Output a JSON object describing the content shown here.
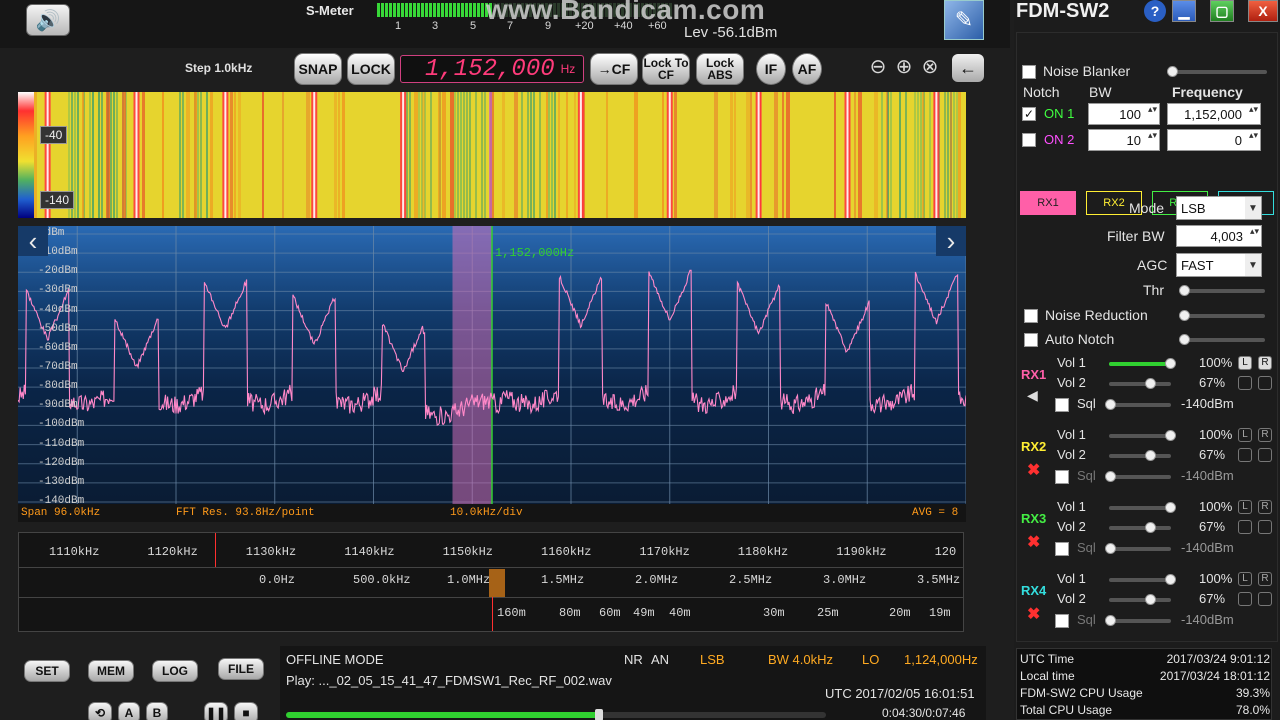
{
  "watermark": "www.Bandicam.com",
  "smeter": {
    "label": "S-Meter",
    "scale": [
      "1",
      "3",
      "5",
      "7",
      "9",
      "+20",
      "+40",
      "+60"
    ],
    "level_text": "Lev -56.1dBm"
  },
  "toolbar": {
    "step": "Step 1.0kHz",
    "snap": "SNAP",
    "lock": "LOCK",
    "frequency": "1,152,000",
    "freq_unit": "Hz",
    "to_cf": "→CF",
    "lock_to_cf": "Lock To CF",
    "lock_abs": "Lock ABS",
    "if": "IF",
    "af": "AF"
  },
  "waterfall": {
    "scale_labels": [
      "-40",
      "-140"
    ]
  },
  "spectrum": {
    "db_labels": [
      "0dBm",
      "-10dBm",
      "-20dBm",
      "-30dBm",
      "-40dBm",
      "-50dBm",
      "-60dBm",
      "-70dBm",
      "-80dBm",
      "-90dBm",
      "-100dBm",
      "-110dBm",
      "-120dBm",
      "-130dBm",
      "-140dBm"
    ],
    "marker_label": "1,152,000Hz",
    "footer": {
      "span": "Span 96.0kHz",
      "fft": "FFT Res. 93.8Hz/point",
      "div": "10.0kHz/div",
      "avg": "AVG = 8"
    }
  },
  "chart_data": {
    "type": "line",
    "x_unit": "kHz",
    "y_unit": "dBm",
    "xlim": [
      1104,
      1200
    ],
    "ylim": [
      -140,
      0
    ],
    "grid": true,
    "peaks_khz": [
      1107,
      1116,
      1125,
      1134,
      1143,
      1161,
      1170,
      1179,
      1188,
      1197
    ],
    "noise_floor_dbm": -85
  },
  "ruler": {
    "khz_ticks": [
      "1110kHz",
      "1120kHz",
      "1130kHz",
      "1140kHz",
      "1150kHz",
      "1160kHz",
      "1170kHz",
      "1180kHz",
      "1190kHz",
      "120"
    ],
    "mhz_ticks": [
      "0.0Hz",
      "500.0kHz",
      "1.0MHz",
      "1.5MHz",
      "2.0MHz",
      "2.5MHz",
      "3.0MHz",
      "3.5MHz"
    ],
    "bands": [
      "160m",
      "80m",
      "60m",
      "49m",
      "40m",
      "30m",
      "25m",
      "20m",
      "19m"
    ]
  },
  "bottom": {
    "buttons": [
      "SET",
      "MEM",
      "LOG",
      "FILE"
    ],
    "ab_a": "A",
    "ab_b": "B",
    "mode_text": "OFFLINE MODE",
    "nr": "NR",
    "an": "AN",
    "demod": "LSB",
    "bw": "BW 4.0kHz",
    "lo_label": "LO",
    "lo_value": "1,124,000Hz",
    "play": "Play: ..._02_05_15_41_47_FDMSW1_Rec_RF_002.wav",
    "utc": "UTC 2017/02/05 16:01:51",
    "time": "0:04:30/0:07:46",
    "progress": 0.58
  },
  "panel": {
    "title": "FDM-SW2",
    "help": "?",
    "noise_blanker": "Noise Blanker",
    "notch": "Notch",
    "bw": "BW",
    "frequency": "Frequency",
    "on1": "ON 1",
    "on2": "ON 2",
    "notch1_bw": "100",
    "notch1_freq": "1,152,000",
    "notch2_bw": "10",
    "notch2_freq": "0",
    "rx_tabs": [
      "RX1",
      "RX2",
      "RX3",
      "RX4"
    ],
    "mode_label": "Mode",
    "mode_value": "LSB",
    "filter_label": "Filter BW",
    "filter_value": "4,003",
    "agc_label": "AGC",
    "agc_value": "FAST",
    "thr_label": "Thr",
    "noise_reduction": "Noise Reduction",
    "auto_notch": "Auto Notch",
    "receivers": [
      {
        "name": "RX1",
        "vol1": "100%",
        "vol2": "67%",
        "sql": "-140dBm",
        "vol1_label": "Vol 1",
        "vol2_label": "Vol 2",
        "sql_label": "Sql",
        "color": "#ff5fa8",
        "vol1_level": 1.0,
        "vol2_level": 0.67
      },
      {
        "name": "RX2",
        "vol1": "100%",
        "vol2": "67%",
        "sql": "-140dBm",
        "vol1_label": "Vol 1",
        "vol2_label": "Vol 2",
        "sql_label": "Sql",
        "color": "#ffee33",
        "vol1_level": 1.0,
        "vol2_level": 0.67
      },
      {
        "name": "RX3",
        "vol1": "100%",
        "vol2": "67%",
        "sql": "-140dBm",
        "vol1_label": "Vol 1",
        "vol2_label": "Vol 2",
        "sql_label": "Sql",
        "color": "#44ee44",
        "vol1_level": 1.0,
        "vol2_level": 0.67
      },
      {
        "name": "RX4",
        "vol1": "100%",
        "vol2": "67%",
        "sql": "-140dBm",
        "vol1_label": "Vol 1",
        "vol2_label": "Vol 2",
        "sql_label": "Sql",
        "color": "#33dddd",
        "vol1_level": 1.0,
        "vol2_level": 0.67
      }
    ],
    "lr_l": "L",
    "lr_r": "R"
  },
  "sysinfo": {
    "utc_label": "UTC Time",
    "utc_value": "2017/03/24 9:01:12",
    "local_label": "Local time",
    "local_value": "2017/03/24 18:01:12",
    "cpu_label": "FDM-SW2 CPU Usage",
    "cpu_value": "39.3%",
    "total_label": "Total CPU Usage",
    "total_value": "78.0%"
  },
  "colors": {
    "accent": "#ff3b7b",
    "spectrum_line": "#ff88c8",
    "marker": "#30d030",
    "footer_text": "#ff9a1a"
  },
  "icons": [
    "speaker-icon",
    "pen-icon",
    "zoom-out-icon",
    "zoom-in-icon",
    "zoom-reset-icon",
    "back-arrow-icon",
    "chevron-left-icon",
    "chevron-right-icon",
    "mute-icon"
  ]
}
